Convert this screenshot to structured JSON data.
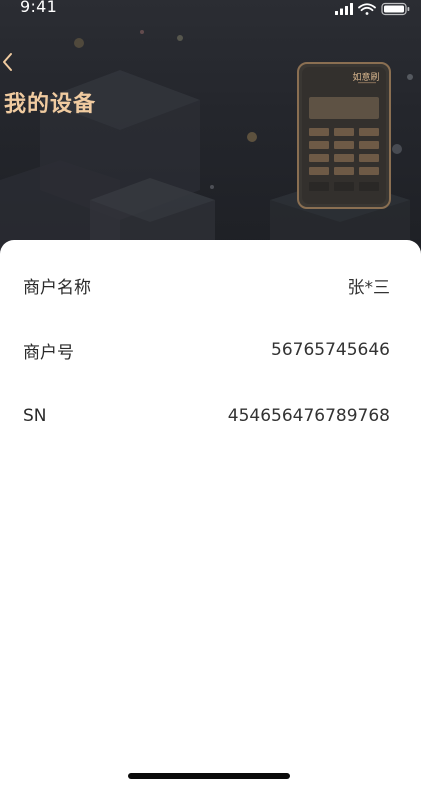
{
  "status_bar": {
    "time": "9:41",
    "icons": [
      "signal-icon",
      "wifi-icon",
      "battery-icon"
    ]
  },
  "header": {
    "title": "我的设备",
    "back_icon": "chevron-left-icon",
    "device_brand": "如意刷",
    "title_color": "#f0cba0",
    "background_color": "#25272d"
  },
  "merchant_info": {
    "rows": [
      {
        "label": "商户名称",
        "value": "张*三"
      },
      {
        "label": "商户号",
        "value": "56765745646"
      },
      {
        "label": "SN",
        "value": "454656476789768"
      }
    ]
  }
}
